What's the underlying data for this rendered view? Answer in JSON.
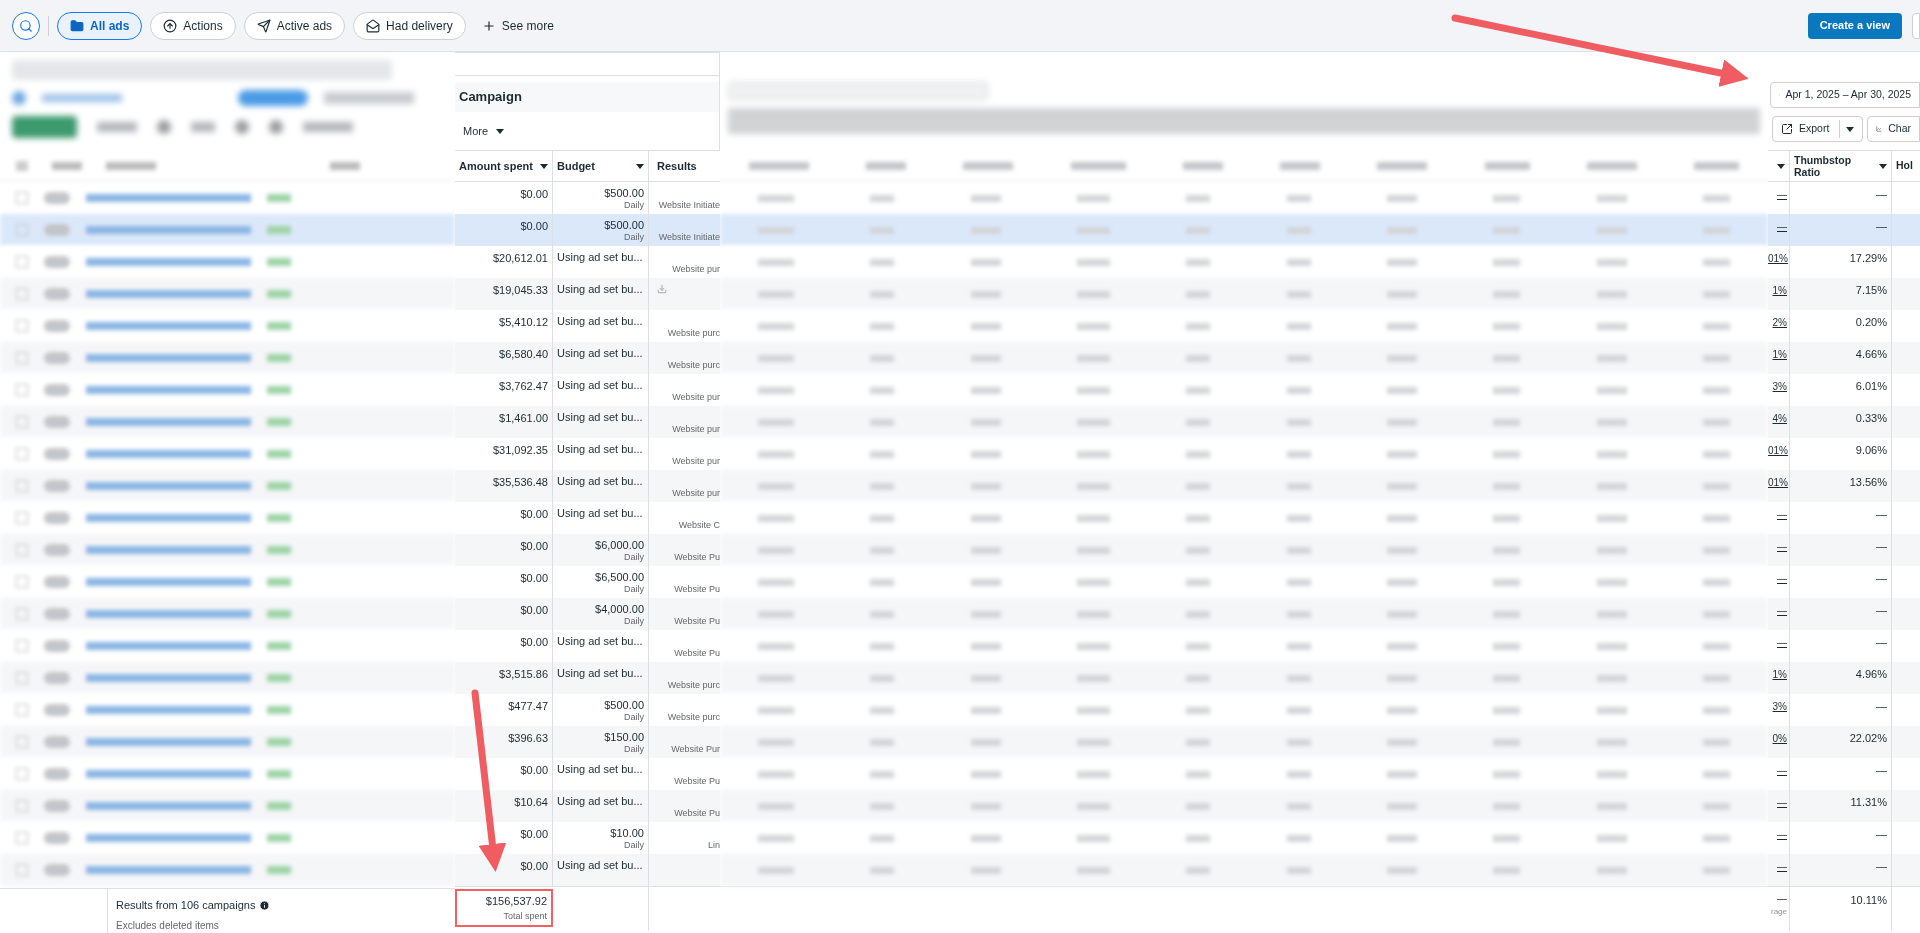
{
  "toolbar": {
    "chips": [
      {
        "label": "All ads",
        "selected": true,
        "kind": "folder"
      },
      {
        "label": "Actions",
        "selected": false,
        "kind": "upload"
      },
      {
        "label": "Active ads",
        "selected": false,
        "kind": "send"
      },
      {
        "label": "Had delivery",
        "selected": false,
        "kind": "mail"
      }
    ],
    "see_more": "See more",
    "create_view": "Create a view"
  },
  "campaign_panel": {
    "title": "Campaign",
    "more": "More"
  },
  "date_range": "Apr 1, 2025 – Apr 30, 2025",
  "export": "Export",
  "chart_button": "Char",
  "table": {
    "columns": {
      "amount": "Amount spent",
      "budget": "Budget",
      "results": "Results",
      "thumbstop": "Thumbstop Ratio",
      "hold": "Hol"
    },
    "rows": [
      {
        "selected": false,
        "amount": "$0.00",
        "budget": "$500.00",
        "budget_period": "Daily",
        "result": "Website Initiate",
        "result_icon": false,
        "column_4": "—",
        "thumbstop": "—"
      },
      {
        "selected": true,
        "amount": "$0.00",
        "budget": "$500.00",
        "budget_period": "Daily",
        "result": "Website Initiate",
        "result_icon": false,
        "column_4": "—",
        "thumbstop": "—"
      },
      {
        "selected": false,
        "amount": "$20,612.01",
        "budget": "Using ad set bu...",
        "result": "Website pur",
        "result_icon": false,
        "column_4": "01%",
        "thumbstop": "17.29%"
      },
      {
        "selected": false,
        "amount": "$19,045.33",
        "budget": "Using ad set bu...",
        "result_icon": true,
        "column_4": "1%",
        "thumbstop": "7.15%"
      },
      {
        "selected": false,
        "amount": "$5,410.12",
        "budget": "Using ad set bu...",
        "result": "Website purc",
        "result_icon": false,
        "column_4": "2%",
        "thumbstop": "0.20%"
      },
      {
        "selected": false,
        "amount": "$6,580.40",
        "budget": "Using ad set bu...",
        "result": "Website purc",
        "result_icon": false,
        "column_4": "1%",
        "thumbstop": "4.66%"
      },
      {
        "selected": false,
        "amount": "$3,762.47",
        "budget": "Using ad set bu...",
        "result": "Website pur",
        "result_icon": false,
        "column_4": "3%",
        "thumbstop": "6.01%"
      },
      {
        "selected": false,
        "amount": "$1,461.00",
        "budget": "Using ad set bu...",
        "result": "Website pur",
        "result_icon": false,
        "column_4": "4%",
        "thumbstop": "0.33%"
      },
      {
        "selected": false,
        "amount": "$31,092.35",
        "budget": "Using ad set bu...",
        "result": "Website pur",
        "result_icon": false,
        "column_4": "01%",
        "thumbstop": "9.06%"
      },
      {
        "selected": false,
        "amount": "$35,536.48",
        "budget": "Using ad set bu...",
        "result": "Website pur",
        "result_icon": false,
        "column_4": "01%",
        "thumbstop": "13.56%"
      },
      {
        "selected": false,
        "amount": "$0.00",
        "budget": "Using ad set bu...",
        "result": "Website C",
        "result_icon": false,
        "column_4": "—",
        "thumbstop": "—"
      },
      {
        "selected": false,
        "amount": "$0.00",
        "budget": "$6,000.00",
        "budget_period": "Daily",
        "result": "Website Pu",
        "result_icon": false,
        "column_4": "—",
        "thumbstop": "—"
      },
      {
        "selected": false,
        "amount": "$0.00",
        "budget": "$6,500.00",
        "budget_period": "Daily",
        "result": "Website Pu",
        "result_icon": false,
        "column_4": "—",
        "thumbstop": "—"
      },
      {
        "selected": false,
        "amount": "$0.00",
        "budget": "$4,000.00",
        "budget_period": "Daily",
        "result": "Website Pu",
        "result_icon": false,
        "column_4": "—",
        "thumbstop": "—"
      },
      {
        "selected": false,
        "amount": "$0.00",
        "budget": "Using ad set bu...",
        "result": "Website Pu",
        "result_icon": false,
        "column_4": "—",
        "thumbstop": "—"
      },
      {
        "selected": false,
        "amount": "$3,515.86",
        "budget": "Using ad set bu...",
        "result": "Website purc",
        "result_icon": false,
        "column_4": "1%",
        "thumbstop": "4.96%"
      },
      {
        "selected": false,
        "amount": "$477.47",
        "budget": "$500.00",
        "budget_period": "Daily",
        "result": "Website purc",
        "result_icon": false,
        "column_4": "3%",
        "thumbstop": "—"
      },
      {
        "selected": false,
        "amount": "$396.63",
        "budget": "$150.00",
        "budget_period": "Daily",
        "result": "Website Pur",
        "result_icon": false,
        "column_4": "0%",
        "thumbstop": "22.02%"
      },
      {
        "selected": false,
        "amount": "$0.00",
        "budget": "Using ad set bu...",
        "result": "Website Pu",
        "result_icon": false,
        "column_4": "—",
        "thumbstop": "—"
      },
      {
        "selected": false,
        "amount": "$10.64",
        "budget": "Using ad set bu...",
        "result": "Website Pu",
        "result_icon": false,
        "column_4": "—",
        "thumbstop": "11.31%"
      },
      {
        "selected": false,
        "amount": "$0.00",
        "budget": "$10.00",
        "budget_period": "Daily",
        "result": "Lin",
        "result_icon": false,
        "column_4": "—",
        "thumbstop": "—"
      },
      {
        "selected": false,
        "amount": "$0.00",
        "budget": "Using ad set bu...",
        "result_icon": false,
        "column_4": "—",
        "thumbstop": "—"
      }
    ],
    "footer": {
      "summary": "Results from 106 campaigns",
      "note": "Excludes deleted items",
      "total": "$156,537.92",
      "total_label": "Total spent",
      "column_4": "—",
      "column_4_label": "rage",
      "thumbstop": "10.11%"
    }
  }
}
